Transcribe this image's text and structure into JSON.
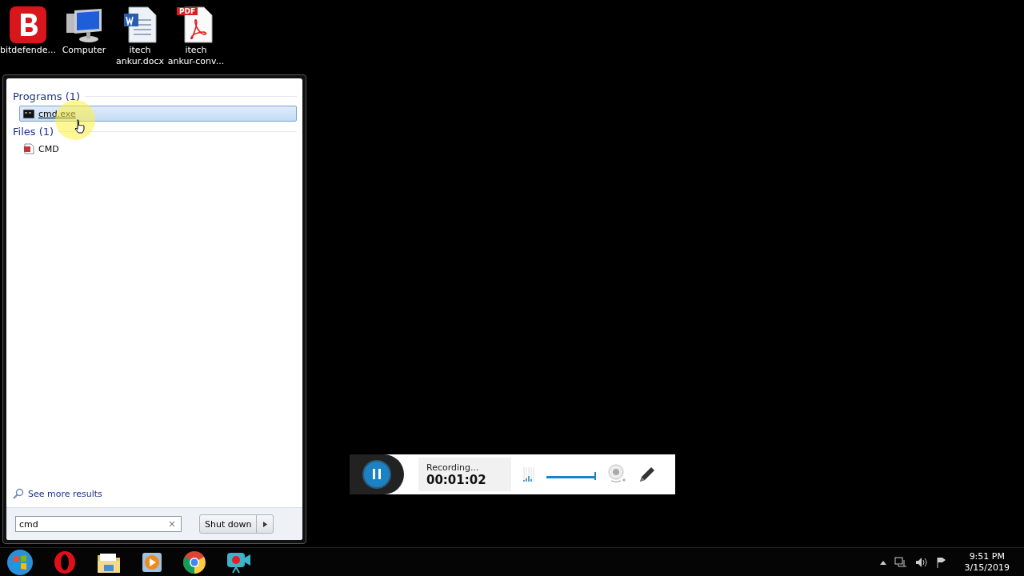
{
  "desktop_icons": [
    {
      "kind": "shield-app",
      "lines": [
        "bitdefende..."
      ]
    },
    {
      "kind": "computer",
      "lines": [
        "Computer"
      ]
    },
    {
      "kind": "word",
      "lines": [
        "itech",
        "ankur.docx"
      ]
    },
    {
      "kind": "pdf",
      "badge": "PDF",
      "lines": [
        "itech",
        "ankur-conv..."
      ]
    }
  ],
  "start_menu": {
    "sections": [
      {
        "title": "Programs (1)",
        "items": [
          {
            "kind": "console",
            "label": "cmd.exe",
            "selected": true
          }
        ]
      },
      {
        "title": "Files (1)",
        "items": [
          {
            "kind": "document",
            "label": "CMD",
            "selected": false
          }
        ]
      }
    ],
    "more_results": "See more results",
    "search": {
      "value": "cmd",
      "clear": "×"
    },
    "shutdown": "Shut down"
  },
  "recorder": {
    "status": "Recording...",
    "time": "00:01:02",
    "volume": {
      "level": 1
    }
  },
  "taskbar": {
    "apps": [
      {
        "kind": "start"
      },
      {
        "kind": "opera"
      },
      {
        "kind": "explorer"
      },
      {
        "kind": "media"
      },
      {
        "kind": "chrome"
      },
      {
        "kind": "recorder"
      }
    ],
    "time": "9:51 PM",
    "date": "3/15/2019"
  }
}
